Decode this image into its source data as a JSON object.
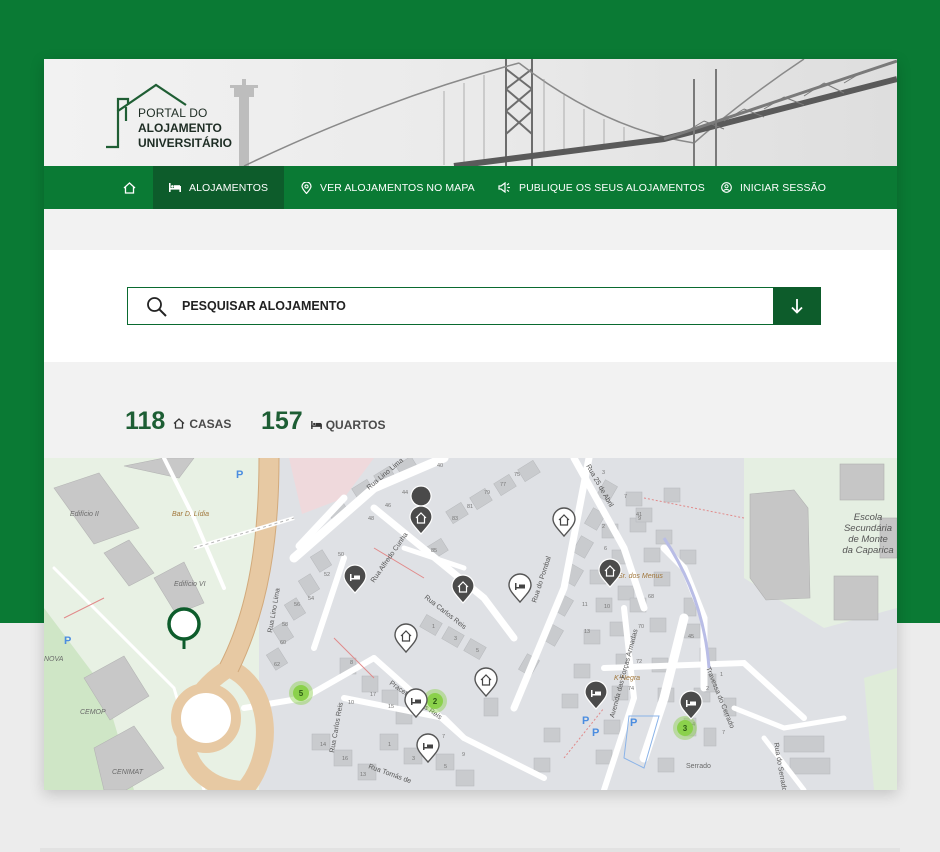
{
  "logo": {
    "line1": "PORTAL DO",
    "line2": "ALOJAMENTO",
    "line3": "UNIVERSITÁRIO"
  },
  "nav": {
    "home_icon": "home-icon",
    "items": [
      {
        "label": "ALOJAMENTOS",
        "icon": "bed-icon",
        "active": true
      },
      {
        "label": "VER ALOJAMENTOS NO MAPA",
        "icon": "map-pin-icon",
        "active": false
      },
      {
        "label": "PUBLIQUE OS SEUS ALOJAMENTOS",
        "icon": "megaphone-icon",
        "active": false
      },
      {
        "label": "INICIAR SESSÃO",
        "icon": "user-icon",
        "active": false
      }
    ]
  },
  "search": {
    "placeholder": "PESQUISAR ALOJAMENTO",
    "search_icon": "search-icon",
    "button_icon": "arrow-down-icon"
  },
  "stats": {
    "houses": {
      "count": "118",
      "label": "CASAS",
      "icon": "house-icon"
    },
    "rooms": {
      "count": "157",
      "label": "QUARTOS",
      "icon": "bed-icon"
    }
  },
  "colors": {
    "brand_green": "#0a7a34",
    "dark_green": "#0d5c2b",
    "cluster_green": "#8bd14b"
  },
  "map": {
    "streets": [
      "Rua Lino Lima",
      "Rua Alfredo Cunha",
      "Rua Carlos Reis",
      "Rua do Pombal",
      "Rua 25 de Abril",
      "Rua Carlos Reis",
      "Praceta Carlos Reis",
      "Rua Tomás de",
      "Rua do Serrado",
      "Avenida das Forças Armadas",
      "Travessa do Cerrado"
    ],
    "places": [
      "Edifício II",
      "Edifício VI",
      "Bar D. Lídia",
      "CEMOP",
      "CENIMAT",
      "NOVA",
      "Escola Secundária de Monte da Caparica",
      "Serrado",
      "Sr. dos Menus",
      "K-Negra"
    ],
    "clusters": [
      "5",
      "2",
      "3"
    ],
    "building_numbers": [
      "40",
      "44",
      "46",
      "48",
      "50",
      "52",
      "54",
      "56",
      "58",
      "60",
      "62",
      "85",
      "83",
      "81",
      "79",
      "77",
      "75",
      "1",
      "3",
      "5",
      "7",
      "9",
      "11",
      "13",
      "15",
      "17",
      "19",
      "2",
      "4",
      "6",
      "8",
      "10",
      "12",
      "14",
      "16",
      "18",
      "45",
      "68",
      "72",
      "74",
      "41"
    ]
  }
}
